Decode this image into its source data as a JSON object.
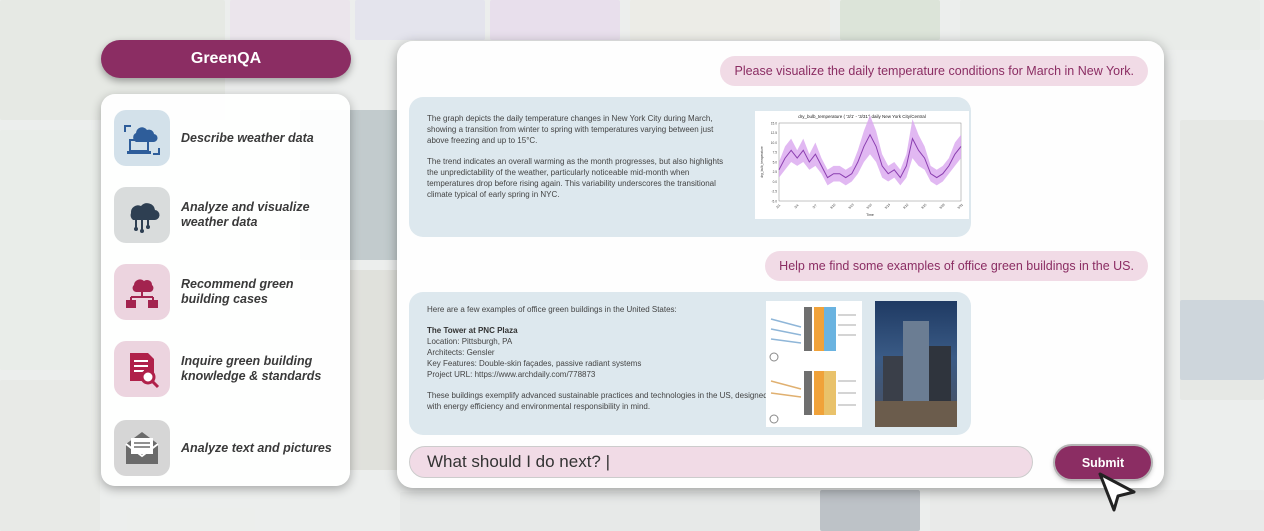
{
  "app": {
    "title": "GreenQA"
  },
  "features": [
    {
      "label": "Describe weather data",
      "icon": "cloud-laptop-icon"
    },
    {
      "label": "Analyze and visualize weather data",
      "icon": "cloud-network-icon"
    },
    {
      "label": "Recommend green building cases",
      "icon": "building-hierarchy-icon"
    },
    {
      "label": "Inquire green building knowledge & standards",
      "icon": "document-search-icon"
    },
    {
      "label": "Analyze text and pictures",
      "icon": "envelope-icon"
    }
  ],
  "chat": {
    "messages": [
      {
        "role": "user",
        "text": "Please visualize the daily temperature conditions for March in New York."
      },
      {
        "role": "assistant",
        "paragraphs": [
          "The graph depicts the daily temperature changes in New York City during March, showing a transition from winter to spring with temperatures varying between just above freezing and up to 15°C.",
          "The trend indicates an overall warming as the month progresses, but also highlights the unpredictability of the weather, particularly noticeable mid-month when temperatures drop before rising again. This variability underscores the transitional climate typical of early spring in NYC."
        ]
      },
      {
        "role": "user",
        "text": "Help me find some examples of office green buildings in the US."
      },
      {
        "role": "assistant",
        "intro": "Here are a few examples of office green buildings in the United States:",
        "building_name": "The Tower at PNC Plaza",
        "details": [
          "Location: Pittsburgh, PA",
          "Architects: Gensler",
          "Key Features: Double-skin façades, passive radiant systems",
          "Project URL: https://www.archdaily.com/778873"
        ],
        "closing": "These buildings exemplify advanced sustainable practices and technologies in the US, designed with energy efficiency and environmental responsibility in mind."
      }
    ],
    "input_value": "What should I do next? |",
    "submit_label": "Submit"
  },
  "chart_data": {
    "type": "line",
    "title": "dry_bulb_temperature ( '3/1' - '3/31') daily New York City/Central",
    "xlabel": "Time",
    "ylabel": "dry_bulb_temperature",
    "x": [
      "3/1",
      "3/2",
      "3/3",
      "3/4",
      "3/5",
      "3/6",
      "3/7",
      "3/8",
      "3/9",
      "3/10",
      "3/11",
      "3/12",
      "3/13",
      "3/14",
      "3/15",
      "3/16",
      "3/17",
      "3/18",
      "3/19",
      "3/20",
      "3/21",
      "3/22",
      "3/23",
      "3/24",
      "3/25",
      "3/26",
      "3/27",
      "3/28",
      "3/29",
      "3/30",
      "3/31"
    ],
    "xticks": [
      "3/1",
      "3/4",
      "3/7",
      "3/10",
      "3/13",
      "3/16",
      "3/19",
      "3/22",
      "3/25",
      "3/28",
      "3/31"
    ],
    "yticks": [
      "15.0",
      "12.5",
      "10.0",
      "7.5",
      "5.0",
      "2.5",
      "0.0",
      "-2.5",
      "-5.0"
    ],
    "ylim": [
      -5,
      15
    ],
    "series": [
      {
        "values": [
          3,
          6,
          8,
          6,
          8,
          5,
          7,
          4,
          1,
          2,
          2,
          1,
          2,
          5,
          9,
          12,
          9,
          4,
          2,
          3,
          1,
          4,
          11,
          8,
          6,
          2,
          1,
          2,
          4,
          7,
          9
        ]
      }
    ],
    "band_halfwidth": [
      2,
      3,
      3,
      2,
      3,
      2,
      3,
      2,
      2,
      2,
      2,
      2,
      2,
      3,
      4,
      5,
      4,
      3,
      2,
      2,
      2,
      3,
      5,
      4,
      3,
      2,
      2,
      2,
      2,
      3,
      3
    ],
    "colors": {
      "line": "#8b3fb0",
      "band": "#d9a6ef"
    }
  },
  "colors": {
    "accent": "#8b2d63",
    "user_bubble": "#f1dbe6",
    "bot_bubble": "#dde8ee"
  }
}
